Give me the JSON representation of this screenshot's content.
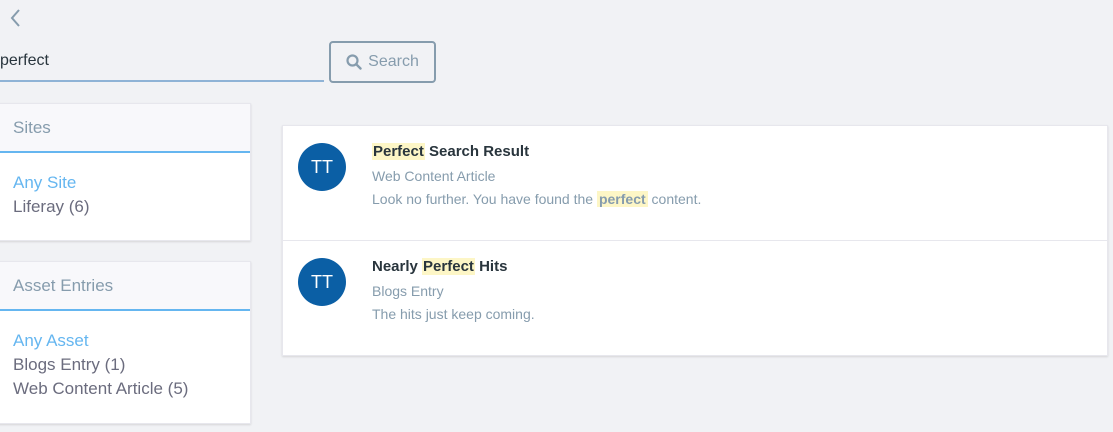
{
  "nav": {
    "back_icon": "chevron-left-icon"
  },
  "search": {
    "value": "perfect",
    "placeholder": "",
    "button_label": "Search",
    "button_icon": "search-icon"
  },
  "facets": [
    {
      "title": "Sites",
      "any_label": "Any Site",
      "items": [
        "Liferay (6)"
      ]
    },
    {
      "title": "Asset Entries",
      "any_label": "Any Asset",
      "items": [
        "Blogs Entry (1)",
        "Web Content Article (5)"
      ]
    }
  ],
  "results": [
    {
      "avatar": "TT",
      "title_highlight": "Perfect",
      "title_rest": " Search Result",
      "type": "Web Content Article",
      "desc_before": "Look no further. You have found the ",
      "desc_highlight": "perfect",
      "desc_after": " content."
    },
    {
      "avatar": "TT",
      "title_before": "Nearly ",
      "title_highlight": "Perfect",
      "title_rest": " Hits",
      "type": "Blogs Entry",
      "desc": "The hits just keep coming."
    }
  ],
  "colors": {
    "accent": "#65b6f0",
    "avatar_bg": "#0b5fa5",
    "highlight": "#fdf6c6",
    "muted_text": "#869cad"
  }
}
